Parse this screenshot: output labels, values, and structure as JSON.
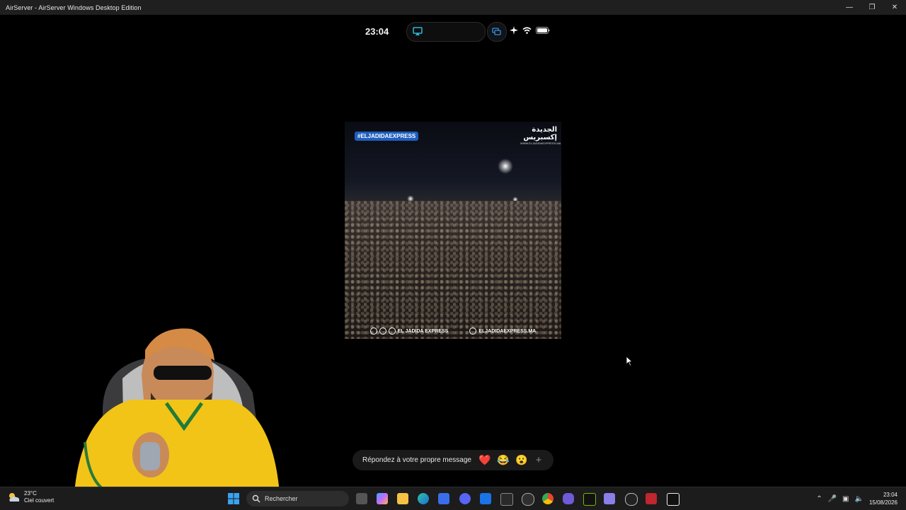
{
  "window": {
    "title": "AirServer - AirServer Windows Desktop Edition"
  },
  "phone_status": {
    "time": "23:04"
  },
  "media": {
    "hashtag": "#ELJADIDAEXPRESS",
    "logo_text": "الجديدة إكسبريس",
    "logo_url": "WWW.ELJADIDAEXPRESS.MA",
    "footer_left": "EL JADIDA EXPRESS",
    "footer_right": "ELJADIDAEXPRESS.MA"
  },
  "reply_bar": {
    "placeholder": "Répondez à votre propre message",
    "emojis": [
      "❤️",
      "😂",
      "😮"
    ],
    "plus": "+"
  },
  "taskbar": {
    "weather_temp": "23°C",
    "weather_desc": "Ciel couvert",
    "search_label": "Rechercher",
    "time": "23:04",
    "date": "15/08/2026"
  },
  "colors": {
    "accent": "#1f5fbf",
    "airplay": "#2fb6d8",
    "heart": "#e0202f"
  }
}
